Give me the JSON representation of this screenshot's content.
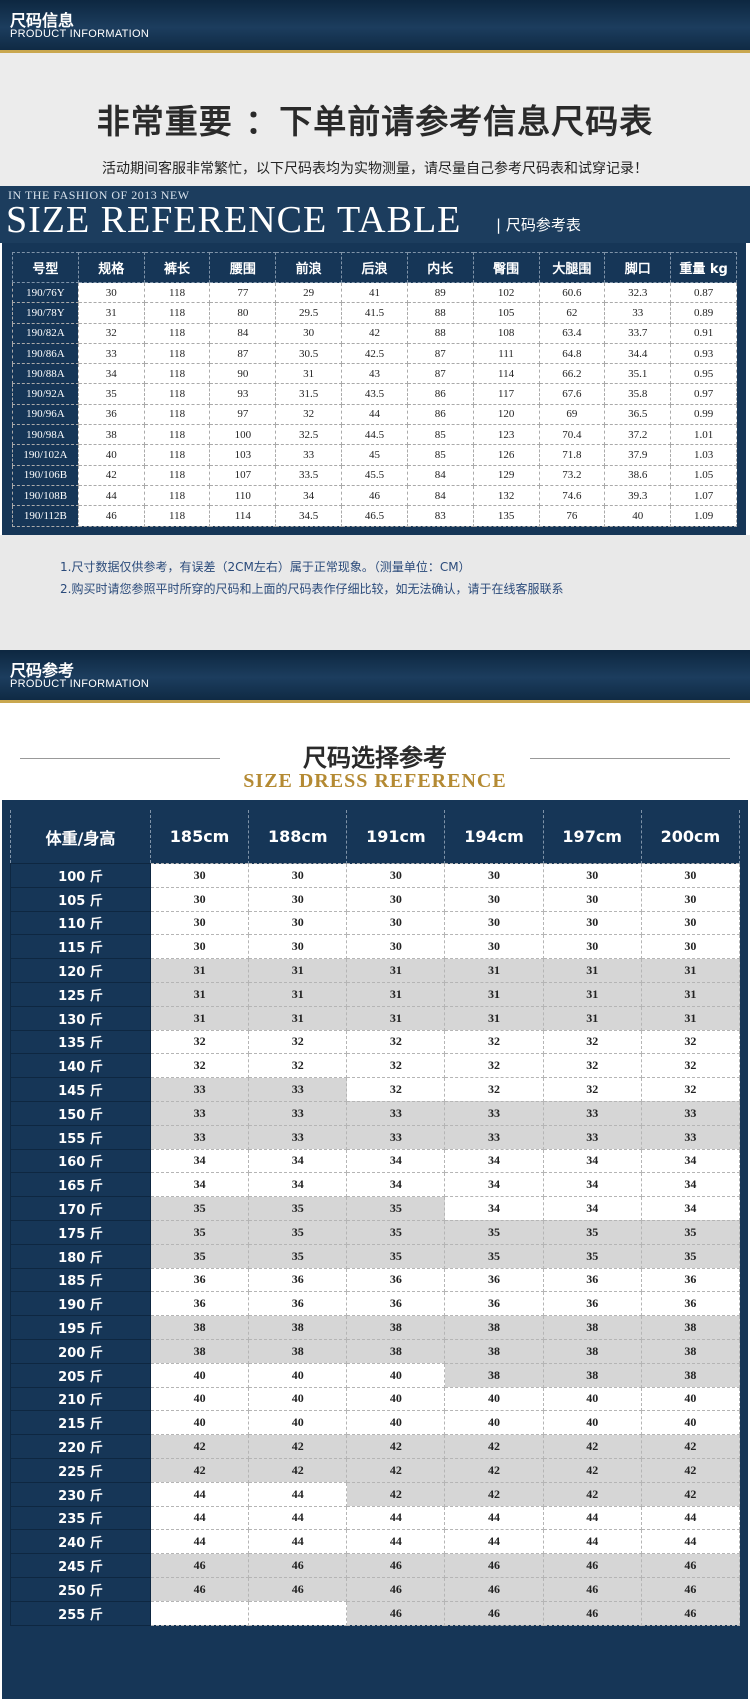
{
  "header1": {
    "title": "尺码信息",
    "subtitle": "PRODUCT INFORMATION"
  },
  "important": "非常重要 ：下单前请参考信息尺码表",
  "notice": "活动期间客服非常繁忙，以下尺码表均为实物测量，请尽量自己参考尺码表和试穿记录！",
  "ref_banner": {
    "small": "IN THE FASHION OF 2013 NEW",
    "big": "SIZE REFERENCE TABLE",
    "cn": "尺码参考表"
  },
  "size_table": {
    "headers": [
      "号型",
      "规格",
      "裤长",
      "腰围",
      "前浪",
      "后浪",
      "内长",
      "臀围",
      "大腿围",
      "脚口",
      "重量 kg"
    ],
    "rows": [
      [
        "190/76Y",
        "30",
        "118",
        "77",
        "29",
        "41",
        "89",
        "102",
        "60.6",
        "32.3",
        "0.87"
      ],
      [
        "190/78Y",
        "31",
        "118",
        "80",
        "29.5",
        "41.5",
        "88",
        "105",
        "62",
        "33",
        "0.89"
      ],
      [
        "190/82A",
        "32",
        "118",
        "84",
        "30",
        "42",
        "88",
        "108",
        "63.4",
        "33.7",
        "0.91"
      ],
      [
        "190/86A",
        "33",
        "118",
        "87",
        "30.5",
        "42.5",
        "87",
        "111",
        "64.8",
        "34.4",
        "0.93"
      ],
      [
        "190/88A",
        "34",
        "118",
        "90",
        "31",
        "43",
        "87",
        "114",
        "66.2",
        "35.1",
        "0.95"
      ],
      [
        "190/92A",
        "35",
        "118",
        "93",
        "31.5",
        "43.5",
        "86",
        "117",
        "67.6",
        "35.8",
        "0.97"
      ],
      [
        "190/96A",
        "36",
        "118",
        "97",
        "32",
        "44",
        "86",
        "120",
        "69",
        "36.5",
        "0.99"
      ],
      [
        "190/98A",
        "38",
        "118",
        "100",
        "32.5",
        "44.5",
        "85",
        "123",
        "70.4",
        "37.2",
        "1.01"
      ],
      [
        "190/102A",
        "40",
        "118",
        "103",
        "33",
        "45",
        "85",
        "126",
        "71.8",
        "37.9",
        "1.03"
      ],
      [
        "190/106B",
        "42",
        "118",
        "107",
        "33.5",
        "45.5",
        "84",
        "129",
        "73.2",
        "38.6",
        "1.05"
      ],
      [
        "190/108B",
        "44",
        "118",
        "110",
        "34",
        "46",
        "84",
        "132",
        "74.6",
        "39.3",
        "1.07"
      ],
      [
        "190/112B",
        "46",
        "118",
        "114",
        "34.5",
        "46.5",
        "83",
        "135",
        "76",
        "40",
        "1.09"
      ]
    ]
  },
  "notes": [
    "1.尺寸数据仅供参考，有误差（2CM左右）属于正常现象。（测量单位：CM）",
    "2.购买时请您参照平时所穿的尺码和上面的尺码表作仔细比较，如无法确认，请于在线客服联系"
  ],
  "header2": {
    "title": "尺码参考",
    "subtitle": "PRODUCT INFORMATION"
  },
  "dress_title": {
    "cn": "尺码选择参考",
    "en": "SIZE DRESS REFERENCE"
  },
  "dress_table": {
    "corner": "体重/身高",
    "heights": [
      "185cm",
      "188cm",
      "191cm",
      "194cm",
      "197cm",
      "200cm"
    ],
    "weights": [
      "100 斤",
      "105 斤",
      "110 斤",
      "115 斤",
      "120 斤",
      "125 斤",
      "130 斤",
      "135 斤",
      "140 斤",
      "145 斤",
      "150 斤",
      "155 斤",
      "160 斤",
      "165 斤",
      "170 斤",
      "175 斤",
      "180 斤",
      "185 斤",
      "190 斤",
      "195 斤",
      "200 斤",
      "205 斤",
      "210 斤",
      "215 斤",
      "220 斤",
      "225 斤",
      "230 斤",
      "235 斤",
      "240 斤",
      "245 斤",
      "250 斤",
      "255 斤"
    ],
    "values": [
      [
        "30",
        "30",
        "30",
        "30",
        "30",
        "30"
      ],
      [
        "30",
        "30",
        "30",
        "30",
        "30",
        "30"
      ],
      [
        "30",
        "30",
        "30",
        "30",
        "30",
        "30"
      ],
      [
        "30",
        "30",
        "30",
        "30",
        "30",
        "30"
      ],
      [
        "31",
        "31",
        "31",
        "31",
        "31",
        "31"
      ],
      [
        "31",
        "31",
        "31",
        "31",
        "31",
        "31"
      ],
      [
        "31",
        "31",
        "31",
        "31",
        "31",
        "31"
      ],
      [
        "32",
        "32",
        "32",
        "32",
        "32",
        "32"
      ],
      [
        "32",
        "32",
        "32",
        "32",
        "32",
        "32"
      ],
      [
        "33",
        "33",
        "32",
        "32",
        "32",
        "32"
      ],
      [
        "33",
        "33",
        "33",
        "33",
        "33",
        "33"
      ],
      [
        "33",
        "33",
        "33",
        "33",
        "33",
        "33"
      ],
      [
        "34",
        "34",
        "34",
        "34",
        "34",
        "34"
      ],
      [
        "34",
        "34",
        "34",
        "34",
        "34",
        "34"
      ],
      [
        "35",
        "35",
        "35",
        "34",
        "34",
        "34"
      ],
      [
        "35",
        "35",
        "35",
        "35",
        "35",
        "35"
      ],
      [
        "35",
        "35",
        "35",
        "35",
        "35",
        "35"
      ],
      [
        "36",
        "36",
        "36",
        "36",
        "36",
        "36"
      ],
      [
        "36",
        "36",
        "36",
        "36",
        "36",
        "36"
      ],
      [
        "38",
        "38",
        "38",
        "38",
        "38",
        "38"
      ],
      [
        "38",
        "38",
        "38",
        "38",
        "38",
        "38"
      ],
      [
        "40",
        "40",
        "40",
        "38",
        "38",
        "38"
      ],
      [
        "40",
        "40",
        "40",
        "40",
        "40",
        "40"
      ],
      [
        "40",
        "40",
        "40",
        "40",
        "40",
        "40"
      ],
      [
        "42",
        "42",
        "42",
        "42",
        "42",
        "42"
      ],
      [
        "42",
        "42",
        "42",
        "42",
        "42",
        "42"
      ],
      [
        "44",
        "44",
        "42",
        "42",
        "42",
        "42"
      ],
      [
        "44",
        "44",
        "44",
        "44",
        "44",
        "44"
      ],
      [
        "44",
        "44",
        "44",
        "44",
        "44",
        "44"
      ],
      [
        "46",
        "46",
        "46",
        "46",
        "46",
        "46"
      ],
      [
        "46",
        "46",
        "46",
        "46",
        "46",
        "46"
      ],
      [
        "",
        "",
        "46",
        "46",
        "46",
        "46"
      ]
    ],
    "shade": [
      "wwwwww",
      "wwwwww",
      "wwwwww",
      "wwwwww",
      "gggggg",
      "gggggg",
      "gggggg",
      "wwwwww",
      "wwwwww",
      "ggwwww",
      "gggggg",
      "gggggg",
      "wwwwww",
      "wwwwww",
      "gggwww",
      "gggggg",
      "gggggg",
      "wwwwww",
      "wwwwww",
      "gggggg",
      "gggggg",
      "wwwggg",
      "wwwwww",
      "wwwwww",
      "gggggg",
      "gggggg",
      "wwgggg",
      "wwwwww",
      "wwwwww",
      "gggggg",
      "gggggg",
      "wwgggg"
    ]
  }
}
